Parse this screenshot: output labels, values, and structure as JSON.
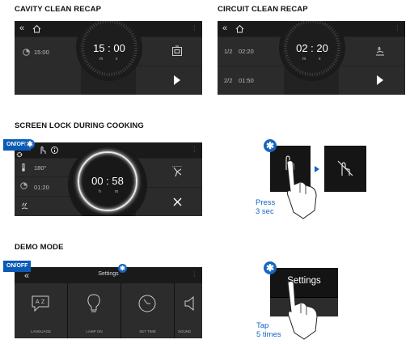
{
  "headings": {
    "cavity": "CAVITY CLEAN RECAP",
    "circuit": "CIRCUIT CLEAN RECAP",
    "screenlock": "SCREEN LOCK DURING COOKING",
    "demo": "DEMO MODE"
  },
  "cavity": {
    "start_time": "15:00",
    "timer": "15 : 00",
    "unit_h": "m",
    "unit_m": "s"
  },
  "circuit": {
    "step1": "1/2",
    "time1": "02:20",
    "step2": "2/2",
    "time2": "01:50",
    "timer": "02 : 20",
    "unit_h": "m",
    "unit_m": "s"
  },
  "screenlock": {
    "badge": "ON/OFF",
    "temperature": "180°",
    "time": "01:20",
    "timer": "00 : 58",
    "unit_h": "h",
    "unit_m": "m",
    "press_line1": "Press",
    "press_line2": "3 sec"
  },
  "demo": {
    "badge": "ON/OFF",
    "title": "Settings",
    "tiles": [
      "LANGUAGE",
      "LAMP ON",
      "SET TIME",
      "SOUND"
    ],
    "zoom_title": "Settings",
    "tap_line1": "Tap",
    "tap_line2": "5 times"
  },
  "colors": {
    "accent": "#1565c0",
    "screen": "#222222"
  }
}
